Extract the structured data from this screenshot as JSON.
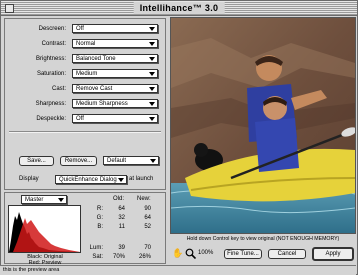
{
  "window": {
    "title": "Intellihance™ 3.0"
  },
  "settings": [
    {
      "label": "Descreen:",
      "value": "Off"
    },
    {
      "label": "Contrast:",
      "value": "Normal"
    },
    {
      "label": "Brightness:",
      "value": "Balanced Tone"
    },
    {
      "label": "Saturation:",
      "value": "Medium"
    },
    {
      "label": "Cast:",
      "value": "Remove Cast"
    },
    {
      "label": "Sharpness:",
      "value": "Medium Sharpness"
    },
    {
      "label": "Despeckle:",
      "value": "Off"
    }
  ],
  "buttons": {
    "save": "Save...",
    "remove": "Remove...",
    "preset": "Default",
    "fine_tune": "Fine Tune...",
    "cancel": "Cancel",
    "apply": "Apply"
  },
  "display": {
    "label": "Display",
    "value": "QuickEnhance Dialog",
    "suffix": "at launch"
  },
  "histogram": {
    "channel": "Master",
    "legend_line1": "Black: Original",
    "legend_line2": "Red: Preview"
  },
  "readout": {
    "col_old": "Old:",
    "col_new": "New:",
    "rows": [
      {
        "label": "R:",
        "old": "64",
        "new": "90"
      },
      {
        "label": "G:",
        "old": "32",
        "new": "64"
      },
      {
        "label": "B:",
        "old": "11",
        "new": "52"
      }
    ],
    "lum": {
      "label": "Lum:",
      "old": "39",
      "new": "70"
    },
    "sat": {
      "label": "Sat:",
      "old": "70%",
      "new": "26%"
    }
  },
  "preview": {
    "message": "Hold down Control key to view original (NOT ENOUGH MEMORY)",
    "zoom": "100%"
  },
  "footer": {
    "status": "this is the preview area"
  },
  "colors": {
    "water": "#4a8fa8",
    "rock": "#7a5a44",
    "kayak": "#e8d43a",
    "vest": "#2f3fa0",
    "background": "#d4d4d4"
  }
}
